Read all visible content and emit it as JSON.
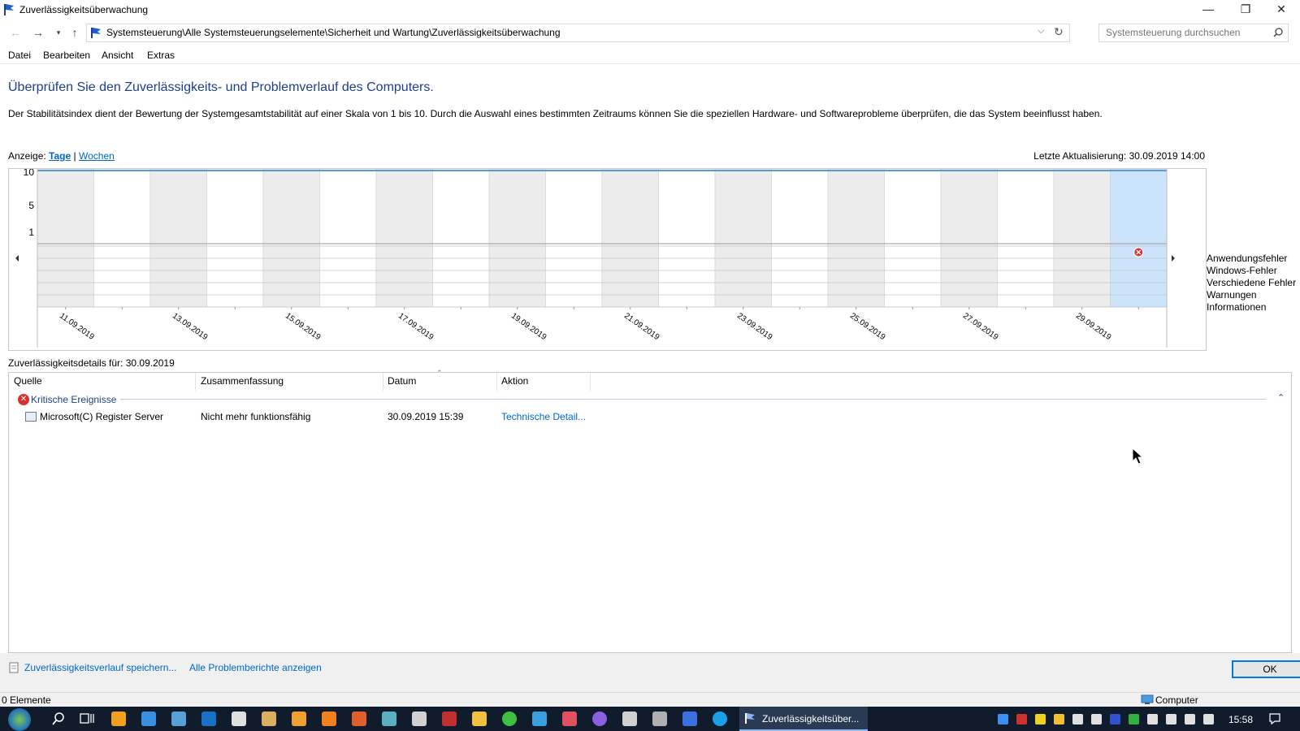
{
  "window": {
    "title": "Zuverlässigkeitsüberwachung",
    "minimize": "—",
    "restore": "❐",
    "close": "✕"
  },
  "address": {
    "path": "Systemsteuerung\\Alle Systemsteuerungselemente\\Sicherheit und Wartung\\Zuverlässigkeitsüberwachung",
    "search_placeholder": "Systemsteuerung durchsuchen"
  },
  "menu": {
    "datei": "Datei",
    "bearbeiten": "Bearbeiten",
    "ansicht": "Ansicht",
    "extras": "Extras"
  },
  "content": {
    "heading": "Überprüfen Sie den Zuverlässigkeits- und Problemverlauf des Computers.",
    "description": "Der Stabilitätsindex dient der Bewertung der Systemgesamtstabilität auf einer Skala von 1 bis 10. Durch die Auswahl eines bestimmten Zeitraums können Sie die speziellen Hardware- und Softwareprobleme überprüfen, die das System beeinflusst haben.",
    "view_label": "Anzeige:",
    "view_days": "Tage",
    "view_separator": "|",
    "view_weeks": "Wochen",
    "last_update": "Letzte Aktualisierung: 30.09.2019 14:00"
  },
  "chart_data": {
    "type": "heatmap",
    "y_ticks": [
      "10",
      "5",
      "1"
    ],
    "ylim": [
      1,
      10
    ],
    "columns": 20,
    "selected_column": 19,
    "x_tick_labels": [
      "11.09.2019",
      "13.09.2019",
      "15.09.2019",
      "17.09.2019",
      "19.09.2019",
      "21.09.2019",
      "23.09.2019",
      "25.09.2019",
      "27.09.2019",
      "29.09.2019"
    ],
    "rows": [
      "Anwendungsfehler",
      "Windows-Fehler",
      "Verschiedene Fehler",
      "Warnungen",
      "Informationen"
    ],
    "events": [
      {
        "row": "Anwendungsfehler",
        "date": "30.09.2019",
        "kind": "critical"
      }
    ]
  },
  "details": {
    "title": "Zuverlässigkeitsdetails für: 30.09.2019",
    "columns": {
      "quelle": "Quelle",
      "zusammenfassung": "Zusammenfassung",
      "datum": "Datum",
      "aktion": "Aktion"
    },
    "group": "Kritische Ereignisse",
    "rows": [
      {
        "quelle": "Microsoft(C) Register Server",
        "zusammenfassung": "Nicht mehr funktionsfähig",
        "datum": "30.09.2019 15:39",
        "aktion": "Technische Detail..."
      }
    ]
  },
  "bottom": {
    "save_link": "Zuverlässigkeitsverlauf speichern...",
    "all_reports_link": "Alle Problemberichte anzeigen",
    "ok": "OK"
  },
  "status": {
    "items": "0 Elemente",
    "computer": "Computer"
  },
  "taskbar": {
    "active_window": "Zuverlässigkeitsüber...",
    "clock": "15:58"
  },
  "colors": {
    "heading": "#1e3f8c",
    "link": "#0066cc",
    "selected_column": "#cce4fb",
    "critical": "#d9302c",
    "taskbar": "#101c2c"
  }
}
